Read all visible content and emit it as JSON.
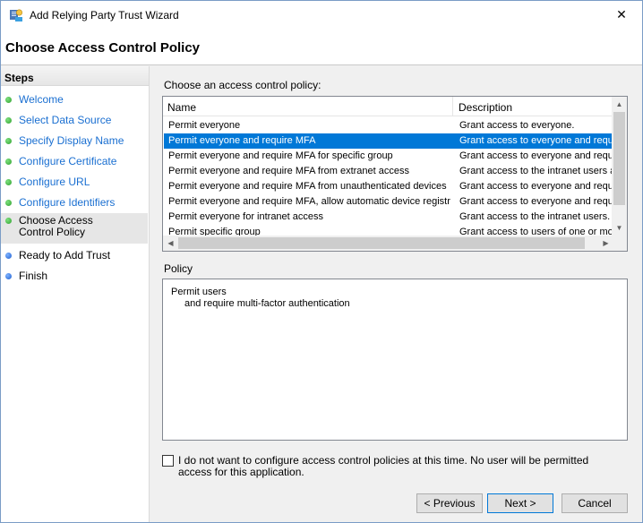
{
  "window": {
    "title": "Add Relying Party Trust Wizard",
    "close_glyph": "✕"
  },
  "header": {
    "page_title": "Choose Access Control Policy"
  },
  "sidebar": {
    "heading": "Steps",
    "items": [
      {
        "label": "Welcome",
        "status": "complete"
      },
      {
        "label": "Select Data Source",
        "status": "complete"
      },
      {
        "label": "Specify Display Name",
        "status": "complete"
      },
      {
        "label": "Configure Certificate",
        "status": "complete"
      },
      {
        "label": "Configure URL",
        "status": "complete"
      },
      {
        "label": "Configure Identifiers",
        "status": "complete"
      },
      {
        "label": "Choose Access Control Policy",
        "status": "current"
      },
      {
        "label": "Ready to Add Trust",
        "status": "pending"
      },
      {
        "label": "Finish",
        "status": "pending"
      }
    ]
  },
  "main": {
    "choose_label": "Choose an access control policy:",
    "list": {
      "columns": [
        "Name",
        "Description"
      ],
      "rows": [
        {
          "name": "Permit everyone",
          "description": "Grant access to everyone."
        },
        {
          "name": "Permit everyone and require MFA",
          "description": "Grant access to everyone and requir",
          "selected": true
        },
        {
          "name": "Permit everyone and require MFA for specific group",
          "description": "Grant access to everyone and requir"
        },
        {
          "name": "Permit everyone and require MFA from extranet access",
          "description": "Grant access to the intranet users ar"
        },
        {
          "name": "Permit everyone and require MFA from unauthenticated devices",
          "description": "Grant access to everyone and requir"
        },
        {
          "name": "Permit everyone and require MFA, allow automatic device registr...",
          "description": "Grant access to everyone and requir"
        },
        {
          "name": "Permit everyone for intranet access",
          "description": "Grant access to the intranet users."
        },
        {
          "name": "Permit specific group",
          "description": "Grant access to users of one or more"
        }
      ]
    },
    "policy_label": "Policy",
    "policy_lines": [
      "Permit users",
      "and require multi-factor authentication"
    ],
    "skip_checkbox": {
      "checked": false,
      "label": "I do not want to configure access control policies at this time. No user will be permitted access for this application."
    }
  },
  "footer": {
    "previous": "< Previous",
    "next": "Next >",
    "cancel": "Cancel"
  },
  "colors": {
    "selection": "#0078d7",
    "step_complete": "#2ea02e",
    "step_pending": "#1f5fd0",
    "link": "#1a6fd1"
  }
}
